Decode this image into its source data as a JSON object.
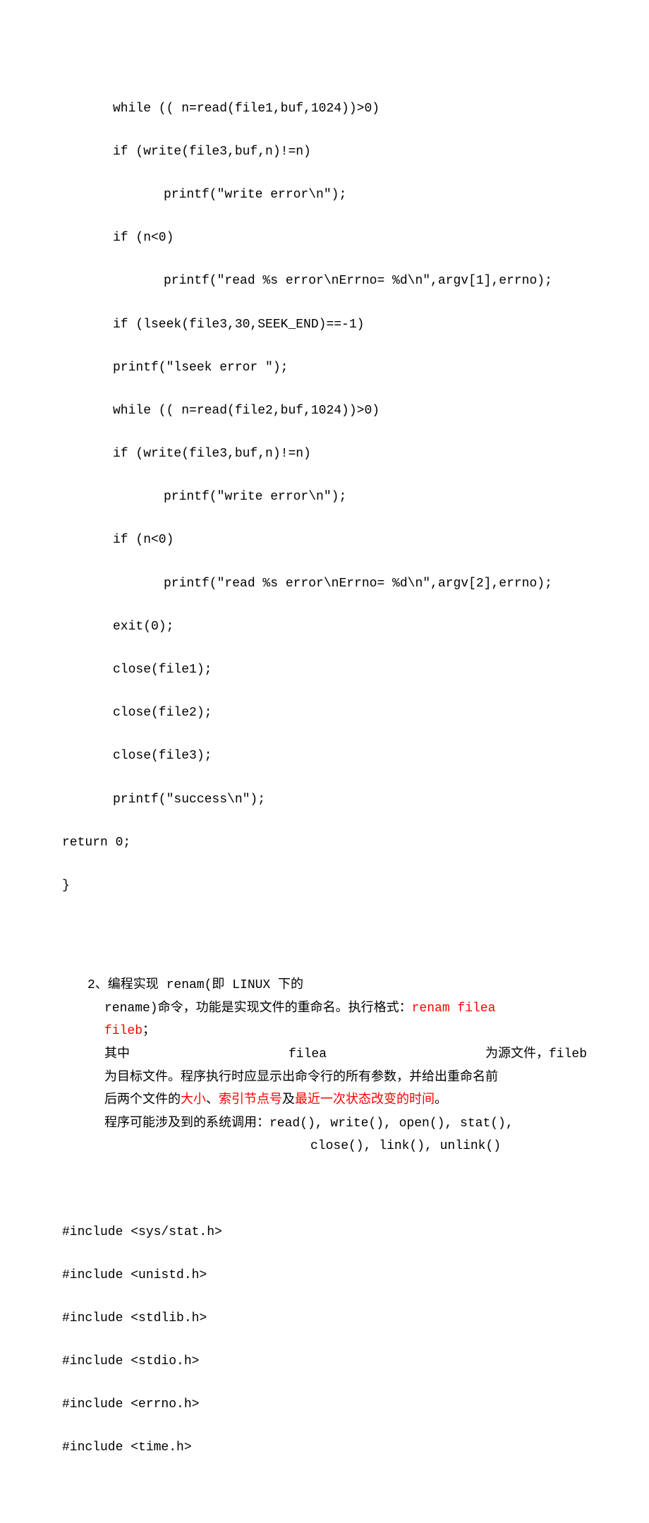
{
  "code1": {
    "l1": "while (( n=read(file1,buf,1024))>0)",
    "l2": "if (write(file3,buf,n)!=n)",
    "l3": "printf(\"write error\\n\");",
    "l4": "if (n<0)",
    "l5": "printf(\"read %s error\\nErrno= %d\\n\",argv[1],errno);",
    "l6": "if (lseek(file3,30,SEEK_END)==-1)",
    "l7": "printf(\"lseek error \");",
    "l8": "while (( n=read(file2,buf,1024))>0)",
    "l9": "if (write(file3,buf,n)!=n)",
    "l10": "printf(\"write error\\n\");",
    "l11": "if (n<0)",
    "l12": "printf(\"read %s error\\nErrno= %d\\n\",argv[2],errno);",
    "l13": "exit(0);",
    "l14": "close(file1);",
    "l15": "close(file2);",
    "l16": "close(file3);",
    "l17": "printf(\"success\\n\");",
    "l18": "return 0;",
    "l19": "}"
  },
  "question": {
    "first": "2、编程实现 renam(即 LINUX 下的",
    "line2_a": "rename)命令，功能是实现文件的重命名。执行格式：",
    "line2_red": "renam filea",
    "line3_red": "fileb",
    "line3_tail": "；",
    "row_a": "其中",
    "row_b": "filea",
    "row_c": "为源文件，fileb",
    "line5": "为目标文件。程序执行时应显示出命令行的所有参数，并给出重命名前",
    "line6_a": "后两个文件的",
    "line6_r1": "大小",
    "line6_sep1": "、",
    "line6_r2": "索引节点号",
    "line6_mid": "及",
    "line6_r3": "最近一次状态改变的时间",
    "line6_tail": "。",
    "line7": "程序可能涉及到的系统调用：read(), write(), open(), stat(),",
    "line8": "close(), link(), unlink()"
  },
  "code2": {
    "l1": "#include <sys/stat.h>",
    "l2": "#include <unistd.h>",
    "l3": "#include <stdlib.h>",
    "l4": "#include <stdio.h>",
    "l5": "#include <errno.h>",
    "l6": "#include <time.h>"
  }
}
